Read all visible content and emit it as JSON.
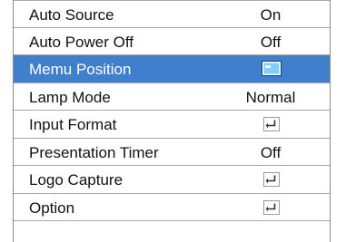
{
  "menu": {
    "rows": [
      {
        "label": "Auto Source",
        "value": "On"
      },
      {
        "label": "Auto Power Off",
        "value": "Off"
      },
      {
        "label": "Memu Position",
        "value_icon": "menu-position-icon",
        "selected": true
      },
      {
        "label": "Lamp Mode",
        "value": "Normal"
      },
      {
        "label": "Input Format",
        "value_icon": "enter-icon"
      },
      {
        "label": "Presentation Timer",
        "value": "Off"
      },
      {
        "label": "Logo Capture",
        "value_icon": "enter-icon"
      },
      {
        "label": "Option",
        "value_icon": "enter-icon"
      }
    ],
    "colors": {
      "selected_background": "#3f7fcb",
      "text": "#111111",
      "selected_text": "#ffffff",
      "row_border": "#a8a8a8"
    }
  }
}
